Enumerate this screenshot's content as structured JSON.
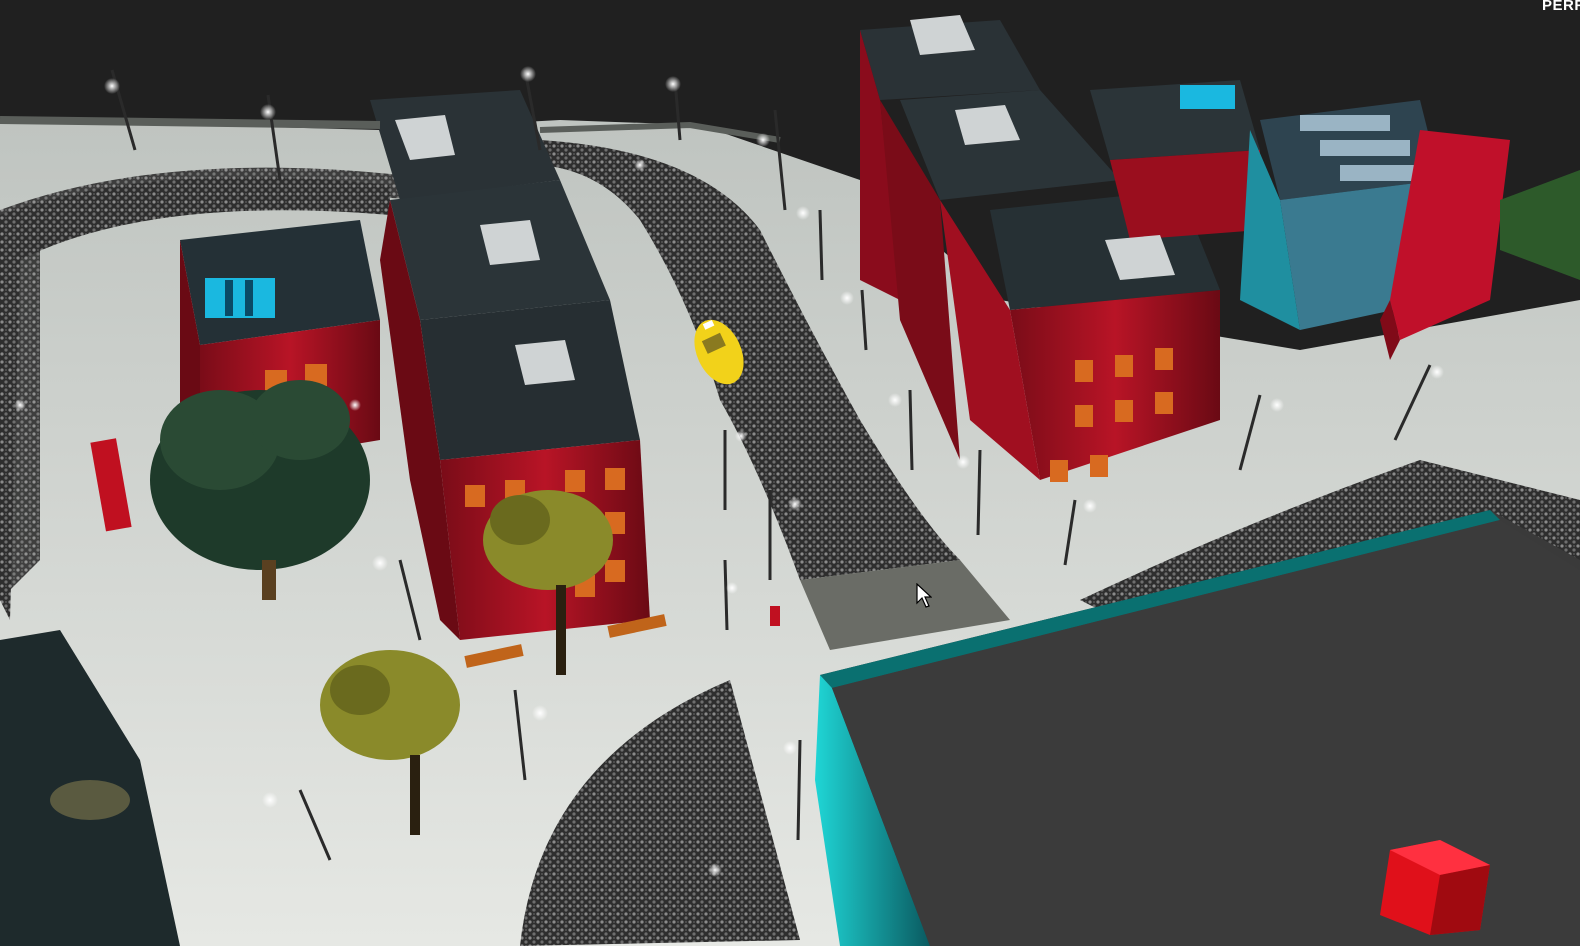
{
  "hud": {
    "corner_label": "PERF"
  },
  "scene": {
    "description_free": true,
    "cursor_icon": "arrow-cursor-icon",
    "colors": {
      "background": "#202020",
      "pavement": "#d8dcd8",
      "street": "#3a3a3a",
      "brick": "#a01020",
      "roof": "#2b3438",
      "teal_edge": "#0a6a6a",
      "taxi": "#f2d21a",
      "box_red": "#e0101a",
      "tree_leaf": "#8a8a2a"
    }
  }
}
